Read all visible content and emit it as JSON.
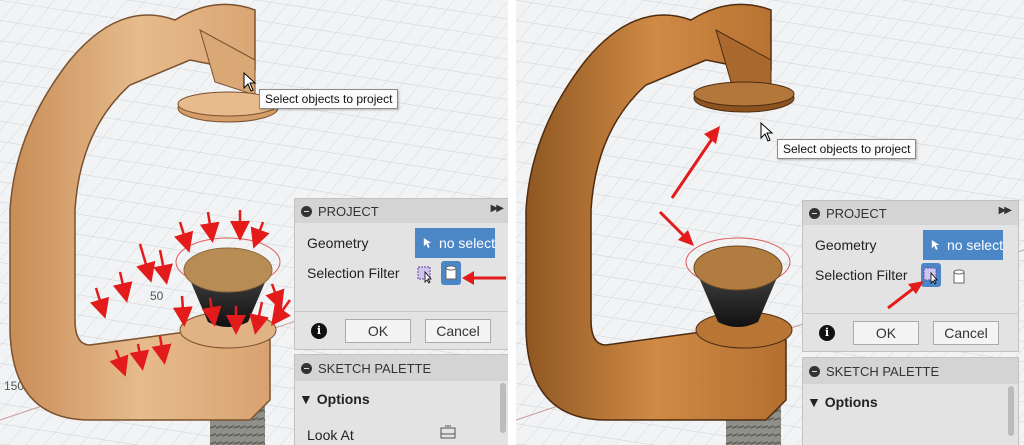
{
  "tooltip_text": "Select objects to project",
  "axis_label": "50",
  "axis_label_2": "150",
  "project_panel": {
    "title": "PROJECT",
    "geometry_label": "Geometry",
    "geometry_button": "no select",
    "selection_filter_label": "Selection Filter",
    "ok": "OK",
    "cancel": "Cancel"
  },
  "sketch_palette": {
    "title": "SKETCH PALETTE",
    "options": "Options",
    "look_at": "Look At"
  },
  "colors": {
    "accent_blue": "#4b86c6",
    "annotation_red": "#e31b1b",
    "clamp_left": "#e2b07f",
    "clamp_right": "#c77d38"
  }
}
